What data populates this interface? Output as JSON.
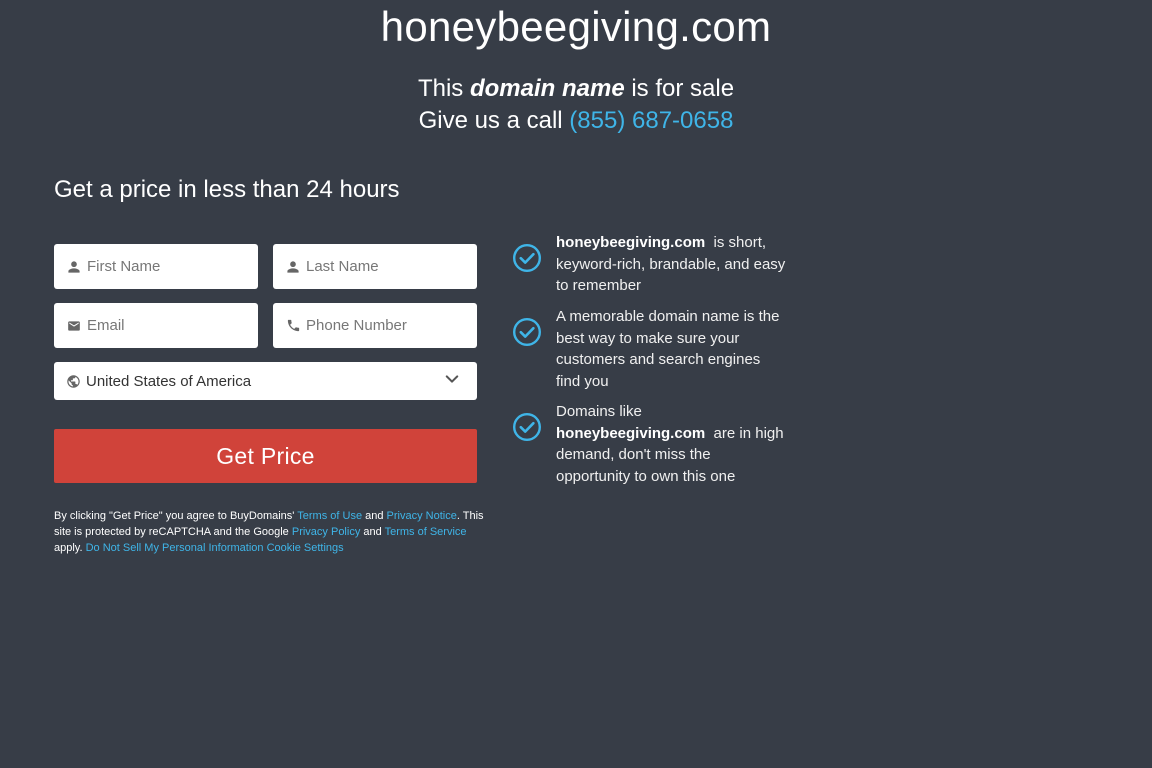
{
  "header": {
    "domain": "honeybeegiving.com",
    "sale_prefix": "This",
    "sale_emphasis": "domain name",
    "sale_suffix": "is for sale",
    "call_text": "Give us a call",
    "phone": "(855) 687-0658"
  },
  "form": {
    "heading": "Get a price in less than 24 hours",
    "first_name_placeholder": "First Name",
    "last_name_placeholder": "Last Name",
    "email_placeholder": "Email",
    "phone_placeholder": "Phone Number",
    "country_value": "United States of America",
    "submit_label": "Get Price"
  },
  "legal": {
    "t1": "By clicking \"Get Price\" you agree to BuyDomains'",
    "terms_of_use": "Terms of Use",
    "and1": "and",
    "privacy_notice": "Privacy Notice",
    "t2": ". This site is protected by reCAPTCHA and the Google",
    "privacy_policy": "Privacy Policy",
    "and2": "and",
    "terms_of_service": "Terms of Service",
    "apply": "apply.",
    "do_not_sell": "Do Not Sell My Personal Information",
    "cookie_settings": "Cookie Settings"
  },
  "benefits": [
    {
      "bold": "honeybeegiving.com",
      "text": "is short, keyword-rich, brandable, and easy to remember"
    },
    {
      "text": "A memorable domain name is the best way to make sure your customers and search engines find you"
    },
    {
      "prefix": "Domains like",
      "bold": "honeybeegiving.com",
      "text": "are in high demand, don't miss the opportunity to own this one"
    }
  ],
  "colors": {
    "background": "#373d47",
    "accent_link": "#3fb5e8",
    "button": "#d0433a"
  },
  "icons": [
    "person-icon",
    "email-icon",
    "phone-icon",
    "globe-icon",
    "chevron-down-icon",
    "check-circle-icon"
  ]
}
